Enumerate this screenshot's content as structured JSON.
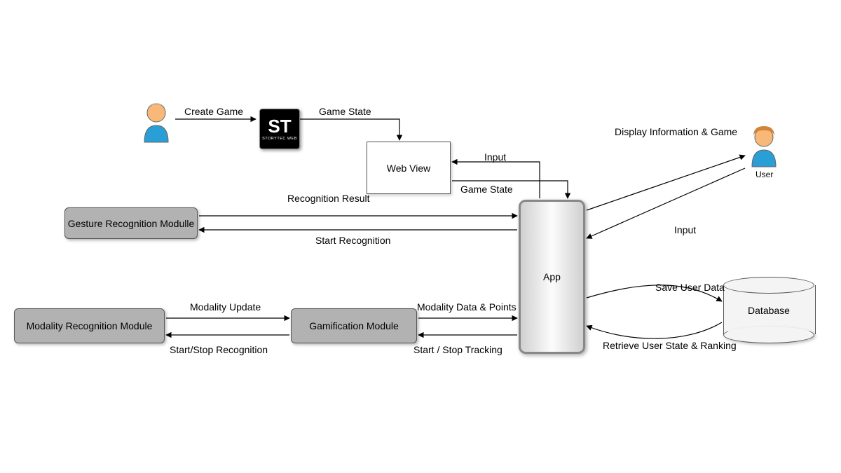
{
  "nodes": {
    "author": "",
    "storytec": "ST",
    "storytec_sub": "STORYTEC WEB",
    "webview": "Web View",
    "gesture": "Gesture Recognition Modulle",
    "modality": "Modality Recognition Module",
    "gamification": "Gamification Module",
    "app": "App",
    "user": "User",
    "database": "Database"
  },
  "edges": {
    "create_game": "Create Game",
    "game_state1": "Game State",
    "input_user_to_webview": "Input",
    "game_state2": "Game State",
    "recognition_result": "Recognition Result",
    "start_recognition": "Start Recognition",
    "modality_update": "Modality Update",
    "start_stop_recognition": "Start/Stop Recognition",
    "modality_data_points": "Modality Data & Points",
    "start_stop_tracking": "Start / Stop Tracking",
    "display_info_game": "Display Information & Game",
    "input_user_to_app": "Input",
    "save_user_data": "Save User Data",
    "retrieve_user_state": "Retrieve User State & Ranking"
  }
}
